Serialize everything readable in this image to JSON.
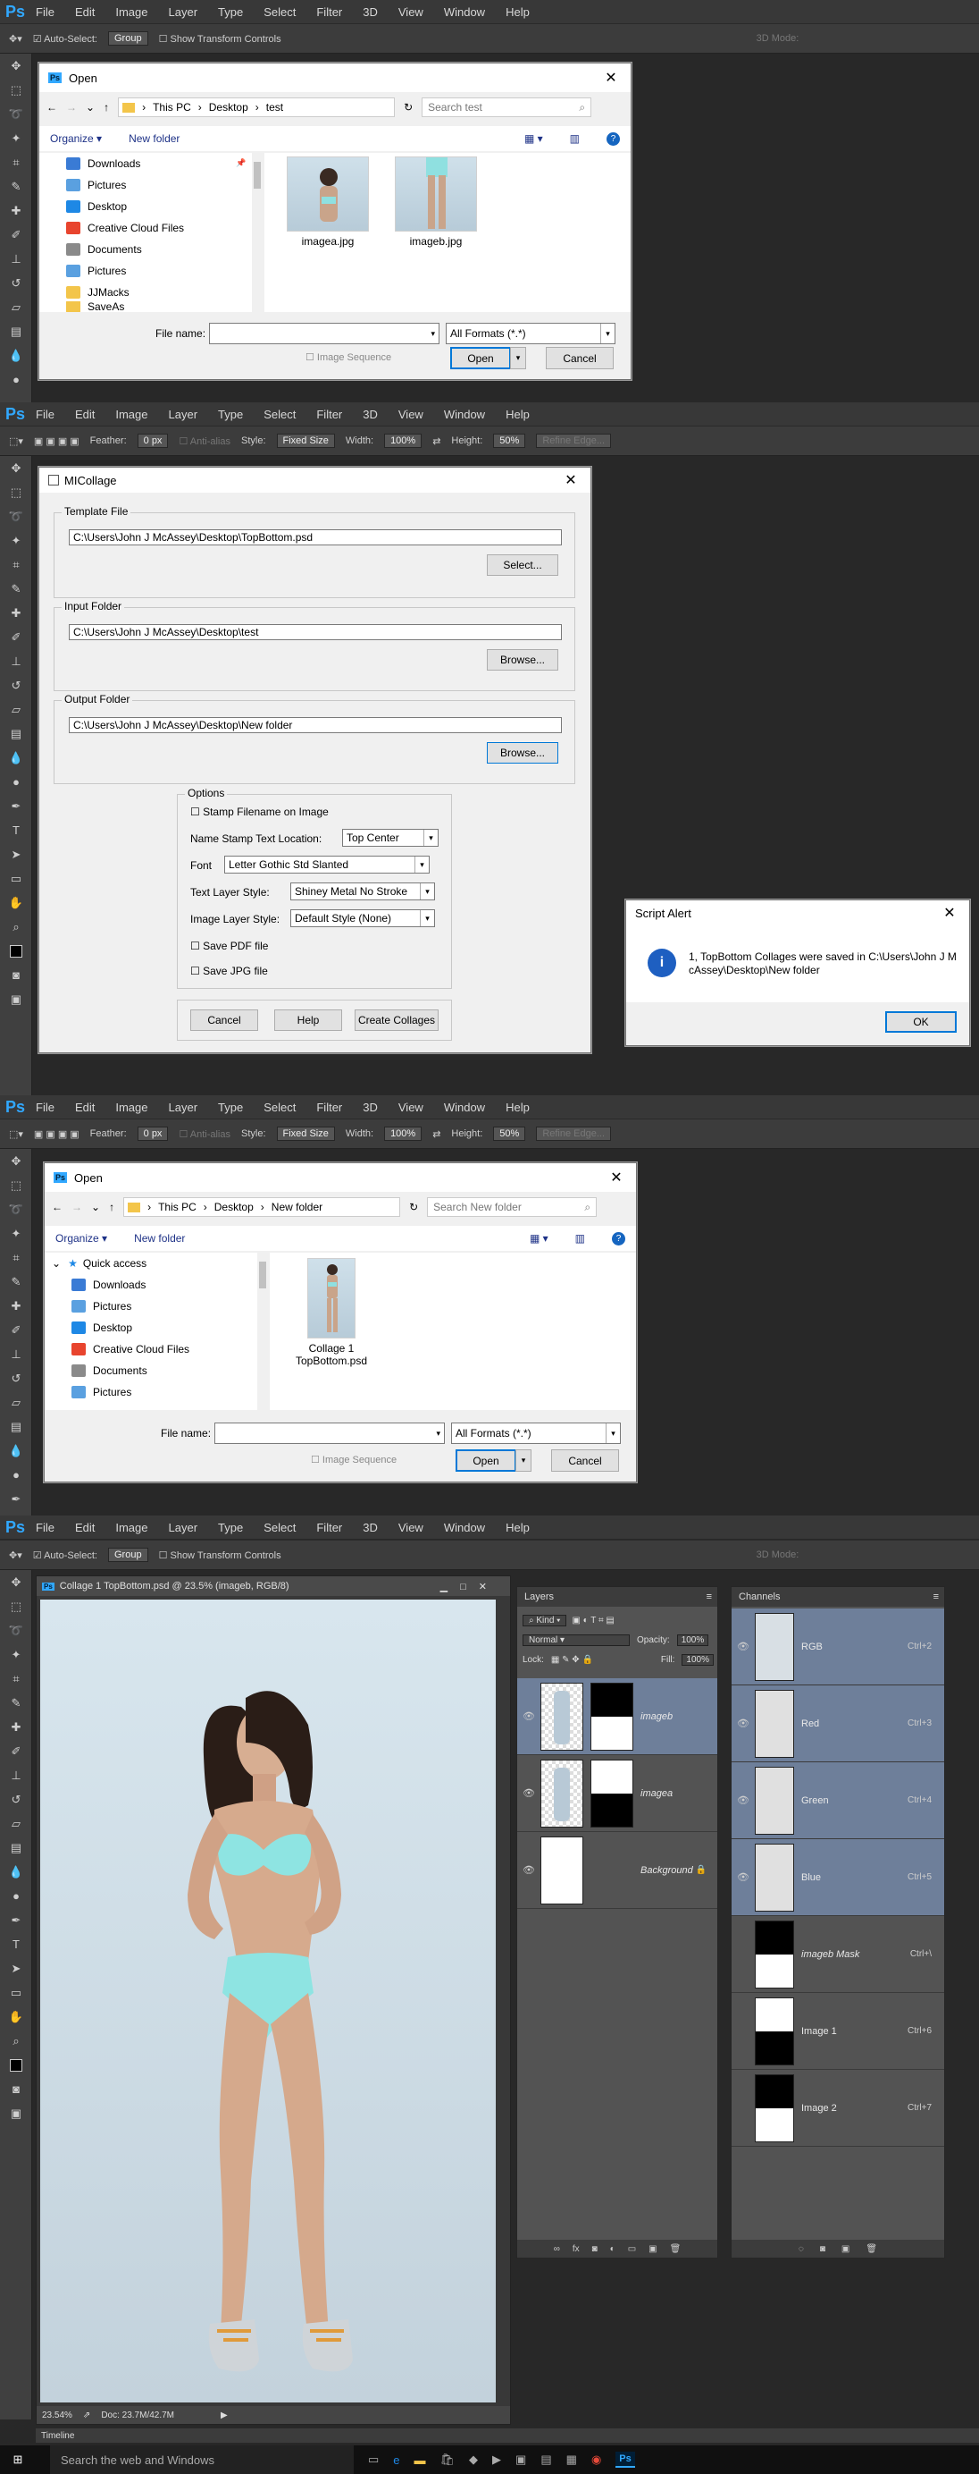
{
  "ps_menu": [
    "File",
    "Edit",
    "Image",
    "Layer",
    "Type",
    "Select",
    "Filter",
    "3D",
    "View",
    "Window",
    "Help"
  ],
  "ps_logo": "Ps",
  "opt_move": {
    "auto_select": "Auto-Select:",
    "group": "Group",
    "transform": "Show Transform Controls",
    "mode3d": "3D Mode:"
  },
  "opt_marquee": {
    "feather_label": "Feather:",
    "feather": "0 px",
    "antialias": "Anti-alias",
    "style_label": "Style:",
    "style": "Fixed Size",
    "width_label": "Width:",
    "width": "100%",
    "height_label": "Height:",
    "height": "50%",
    "refine": "Refine Edge..."
  },
  "open1": {
    "title": "Open",
    "crumbs": [
      "This PC",
      "Desktop",
      "test"
    ],
    "search": "Search test",
    "organize": "Organize",
    "new_folder": "New folder",
    "nav": [
      "Downloads",
      "Pictures",
      "Desktop",
      "Creative Cloud Files",
      "Documents",
      "Pictures",
      "JJMacks",
      "SaveAs"
    ],
    "files": [
      "imagea.jpg",
      "imageb.jpg"
    ],
    "filename_label": "File name:",
    "format": "All Formats (*.*)",
    "sequence": "Image Sequence",
    "open": "Open",
    "cancel": "Cancel"
  },
  "micollage": {
    "title": "MICollage",
    "template_label": "Template File",
    "template_path": "C:\\Users\\John J McAssey\\Desktop\\TopBottom.psd",
    "select": "Select...",
    "input_label": "Input Folder",
    "input_path": "C:\\Users\\John J McAssey\\Desktop\\test",
    "output_label": "Output Folder",
    "output_path": "C:\\Users\\John J McAssey\\Desktop\\New folder",
    "browse": "Browse...",
    "options_label": "Options",
    "stamp": "Stamp Filename on Image",
    "name_stamp_label": "Name Stamp Text  Location:",
    "name_stamp": "Top Center",
    "font_label": "Font",
    "font": "Letter Gothic Std Slanted",
    "text_style_label": "Text Layer Style:",
    "text_style": "Shiney Metal No Stroke",
    "image_style_label": "Image Layer Style:",
    "image_style": "Default Style (None)",
    "save_pdf": "Save PDF file",
    "save_jpg": "Save JPG file",
    "cancel": "Cancel",
    "help": "Help",
    "create": "Create Collages"
  },
  "alert": {
    "title": "Script Alert",
    "message": "1, TopBottom Collages were saved in C:\\Users\\John J McAssey\\Desktop\\New folder",
    "ok": "OK"
  },
  "open2": {
    "title": "Open",
    "crumbs": [
      "This PC",
      "Desktop",
      "New folder"
    ],
    "search": "Search New folder",
    "organize": "Organize",
    "new_folder": "New folder",
    "quick": "Quick access",
    "nav": [
      "Downloads",
      "Pictures",
      "Desktop",
      "Creative Cloud Files",
      "Documents",
      "Pictures"
    ],
    "file": "Collage 1\nTopBottom.psd",
    "filename_label": "File name:",
    "format": "All Formats (*.*)",
    "sequence": "Image Sequence",
    "open": "Open",
    "cancel": "Cancel"
  },
  "doc": {
    "title": "Collage 1 TopBottom.psd @ 23.5% (imageb, RGB/8)",
    "zoom": "23.54%",
    "docsize": "Doc: 23.7M/42.7M"
  },
  "layers": {
    "tab": "Layers",
    "kind": "Kind",
    "blend": "Normal",
    "opacity_label": "Opacity:",
    "opacity": "100%",
    "lock_label": "Lock:",
    "fill_label": "Fill:",
    "fill": "100%",
    "items": [
      "imageb",
      "imagea",
      "Background"
    ]
  },
  "channels": {
    "tab": "Channels",
    "items": [
      {
        "name": "RGB",
        "key": "Ctrl+2"
      },
      {
        "name": "Red",
        "key": "Ctrl+3"
      },
      {
        "name": "Green",
        "key": "Ctrl+4"
      },
      {
        "name": "Blue",
        "key": "Ctrl+5"
      },
      {
        "name": "imageb Mask",
        "key": "Ctrl+\\"
      },
      {
        "name": "Image 1",
        "key": "Ctrl+6"
      },
      {
        "name": "Image 2",
        "key": "Ctrl+7"
      }
    ]
  },
  "timeline": "Timeline",
  "taskbar": {
    "search": "Search the web and Windows"
  }
}
